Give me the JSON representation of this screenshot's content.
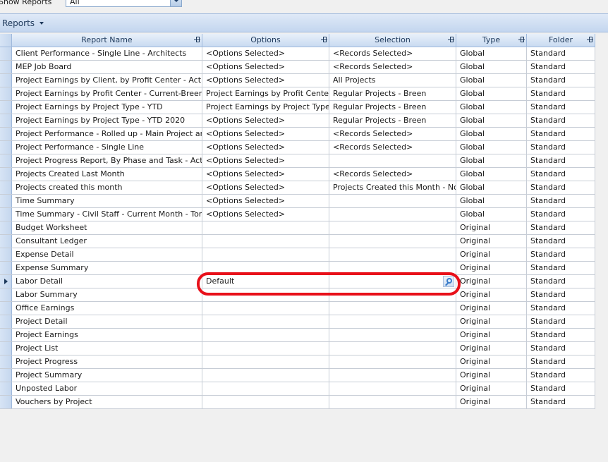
{
  "filter": {
    "label": "Show Reports",
    "value": "All"
  },
  "section_title": "Reports",
  "columns": [
    "Report Name",
    "Options",
    "Selection",
    "Type",
    "Folder"
  ],
  "rows": [
    {
      "name": "Client Performance - Single Line - Architects",
      "options": "<Options Selected>",
      "selection": "<Records Selected>",
      "type": "Global",
      "folder": "Standard"
    },
    {
      "name": "MEP Job Board",
      "options": "<Options Selected>",
      "selection": "<Records Selected>",
      "type": "Global",
      "folder": "Standard"
    },
    {
      "name": "Project Earnings by Client, by Profit Center - Active P",
      "options": "<Options Selected>",
      "selection": "All Projects",
      "type": "Global",
      "folder": "Standard"
    },
    {
      "name": "Project Earnings by Profit Center - Current-Breen",
      "options": "Project Earnings by Profit Center -",
      "selection": "Regular Projects - Breen",
      "type": "Global",
      "folder": "Standard"
    },
    {
      "name": "Project Earnings by Project Type - YTD",
      "options": "Project Earnings by Project Type -",
      "selection": "Regular Projects - Breen",
      "type": "Global",
      "folder": "Standard"
    },
    {
      "name": "Project Earnings by Project Type - YTD 2020",
      "options": "<Options Selected>",
      "selection": "Regular Projects - Breen",
      "type": "Global",
      "folder": "Standard"
    },
    {
      "name": "Project Performance - Rolled up - Main Project and E",
      "options": "<Options Selected>",
      "selection": "<Records Selected>",
      "type": "Global",
      "folder": "Standard"
    },
    {
      "name": "Project Performance - Single Line",
      "options": "<Options Selected>",
      "selection": "<Records Selected>",
      "type": "Global",
      "folder": "Standard"
    },
    {
      "name": "Project Progress Report, By Phase and Task - Active",
      "options": "<Options Selected>",
      "selection": "",
      "type": "Global",
      "folder": "Standard"
    },
    {
      "name": "Projects Created Last Month",
      "options": "<Options Selected>",
      "selection": "<Records Selected>",
      "type": "Global",
      "folder": "Standard"
    },
    {
      "name": "Projects created this month",
      "options": "<Options Selected>",
      "selection": "Projects Created this Month - Non-",
      "type": "Global",
      "folder": "Standard"
    },
    {
      "name": "Time Summary",
      "options": "<Options Selected>",
      "selection": "",
      "type": "Global",
      "folder": "Standard"
    },
    {
      "name": "Time Summary - Civil Staff - Current Month - Torranc",
      "options": "<Options Selected>",
      "selection": "",
      "type": "Global",
      "folder": "Standard"
    },
    {
      "name": "Budget Worksheet",
      "options": "",
      "selection": "",
      "type": "Original",
      "folder": "Standard"
    },
    {
      "name": "Consultant Ledger",
      "options": "",
      "selection": "",
      "type": "Original",
      "folder": "Standard"
    },
    {
      "name": "Expense Detail",
      "options": "",
      "selection": "",
      "type": "Original",
      "folder": "Standard"
    },
    {
      "name": "Expense Summary",
      "options": "",
      "selection": "",
      "type": "Original",
      "folder": "Standard"
    },
    {
      "name": "Labor Detail",
      "options": "Default",
      "selection": "",
      "type": "Original",
      "folder": "Standard",
      "active": true
    },
    {
      "name": "Labor Summary",
      "options": "",
      "selection": "",
      "type": "Original",
      "folder": "Standard"
    },
    {
      "name": "Office Earnings",
      "options": "",
      "selection": "",
      "type": "Original",
      "folder": "Standard"
    },
    {
      "name": "Project Detail",
      "options": "",
      "selection": "",
      "type": "Original",
      "folder": "Standard"
    },
    {
      "name": "Project Earnings",
      "options": "",
      "selection": "",
      "type": "Original",
      "folder": "Standard"
    },
    {
      "name": "Project List",
      "options": "",
      "selection": "",
      "type": "Original",
      "folder": "Standard"
    },
    {
      "name": "Project Progress",
      "options": "",
      "selection": "",
      "type": "Original",
      "folder": "Standard"
    },
    {
      "name": "Project Summary",
      "options": "",
      "selection": "",
      "type": "Original",
      "folder": "Standard"
    },
    {
      "name": "Unposted Labor",
      "options": "",
      "selection": "",
      "type": "Original",
      "folder": "Standard"
    },
    {
      "name": "Vouchers by Project",
      "options": "",
      "selection": "",
      "type": "Original",
      "folder": "Standard"
    }
  ],
  "colors": {
    "highlight": "#e8101a",
    "header": "#c9dbf1",
    "border": "#9fb9dc"
  },
  "icons": {
    "lookup": "magnifier-icon",
    "pin": "pin-icon"
  }
}
